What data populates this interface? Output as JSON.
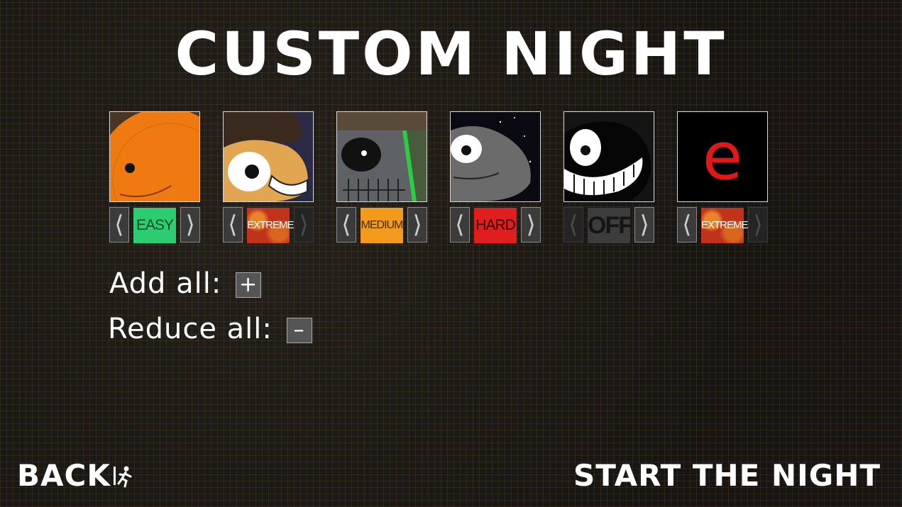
{
  "title": "CUSTOM NIGHT",
  "characters": [
    {
      "level": "EASY",
      "level_class": "lvl-easy",
      "left_enabled": true,
      "right_enabled": true
    },
    {
      "level": "EXTREME",
      "level_class": "lvl-extreme",
      "left_enabled": true,
      "right_enabled": false
    },
    {
      "level": "MEDIUM",
      "level_class": "lvl-medium",
      "left_enabled": true,
      "right_enabled": true
    },
    {
      "level": "HARD",
      "level_class": "lvl-hard",
      "left_enabled": true,
      "right_enabled": true
    },
    {
      "level": "OFF",
      "level_class": "lvl-off",
      "left_enabled": false,
      "right_enabled": true
    },
    {
      "level": "EXTREME",
      "level_class": "lvl-extreme",
      "left_enabled": true,
      "right_enabled": false
    }
  ],
  "arrows": {
    "left": "⟨",
    "right": "⟩"
  },
  "bulk": {
    "add_label": "Add all:",
    "add_symbol": "+",
    "reduce_label": "Reduce all:",
    "reduce_symbol": "–"
  },
  "portrait_6_letter": "e",
  "footer": {
    "back_label": "BACK",
    "back_icon": "running-man-icon",
    "start_label": "START THE NIGHT"
  },
  "colors": {
    "easy": "#2ecc71",
    "medium": "#f29a1c",
    "hard": "#e01e1e",
    "extreme": "#c0321c",
    "off": "#3c3c3c"
  }
}
